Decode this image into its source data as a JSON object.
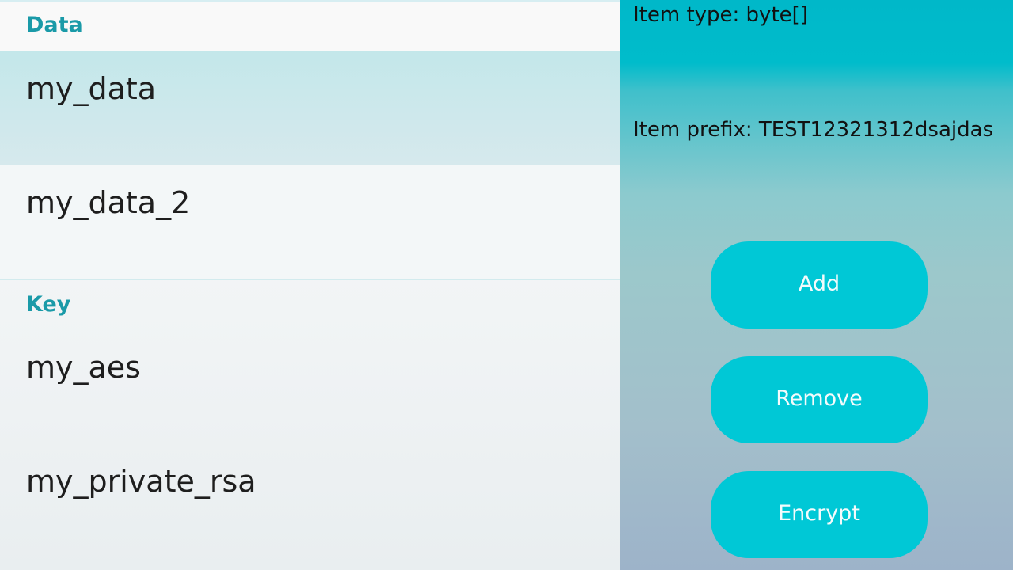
{
  "list": {
    "groups": [
      {
        "header": "Data",
        "items": [
          {
            "label": "my_data",
            "selected": true
          },
          {
            "label": "my_data_2",
            "selected": false
          }
        ]
      },
      {
        "header": "Key",
        "items": [
          {
            "label": "my_aes",
            "selected": false
          },
          {
            "label": "my_private_rsa",
            "selected": false
          }
        ]
      }
    ]
  },
  "details": {
    "item_type": "Item type: byte[]",
    "item_prefix": "Item prefix: TEST12321312dsajdas"
  },
  "actions": {
    "add_label": "Add",
    "remove_label": "Remove",
    "encrypt_label": "Encrypt"
  },
  "colors": {
    "accent": "#00c8d6",
    "header_text": "#1a9aa8",
    "selected_row": "#c3e7ea"
  }
}
